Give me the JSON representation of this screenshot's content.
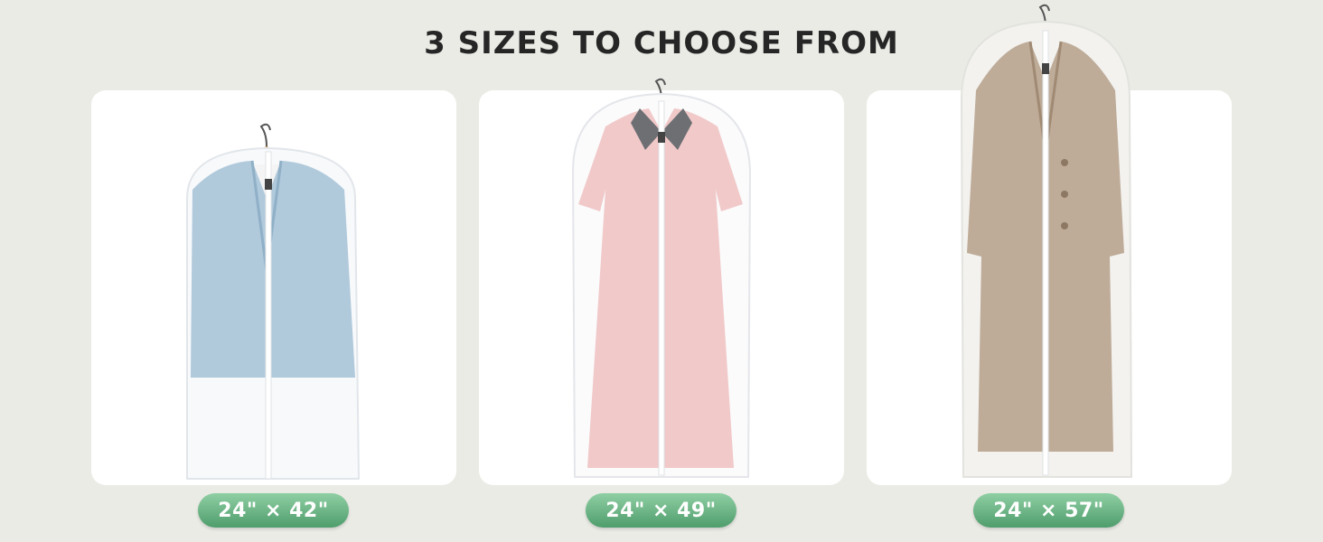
{
  "headline": "3 SIZES TO CHOOSE FROM",
  "sizes": [
    {
      "label": "24\" × 42\"",
      "garment": "suit jacket",
      "icon": "jacket-in-garment-bag"
    },
    {
      "label": "24\" × 49\"",
      "garment": "dress",
      "icon": "dress-in-garment-bag"
    },
    {
      "label": "24\" × 57\"",
      "garment": "long coat",
      "icon": "coat-in-garment-bag"
    }
  ],
  "colors": {
    "background": "#ebebe6",
    "card": "#ffffff",
    "pill_top": "#8fcfa3",
    "pill_bottom": "#4f9d6c",
    "jacket": "#a9c4d8",
    "dress": "#f0c6c6",
    "collar": "#6d6f73",
    "coat": "#b8a48f"
  }
}
